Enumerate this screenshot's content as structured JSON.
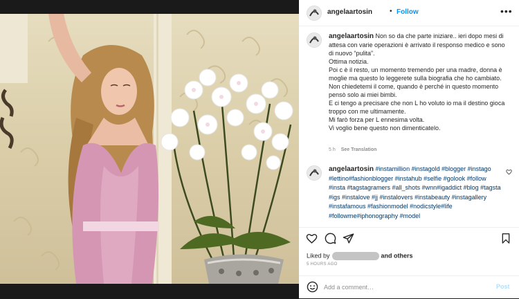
{
  "post": {
    "username": "angelaartosin",
    "separator": "•",
    "follow_label": "Follow",
    "more_label": "•••",
    "image_alt": "Woman in pink satin dress beside white orchids"
  },
  "caption": {
    "username": "angelaartosin",
    "lines": [
      "Non so da che parte iniziare.. ieri dopo mesi di attesa con varie operazioni è arrivato il responso medico e sono di nuovo “pulita”.",
      "Ottima notizia.",
      "Poi c è il resto, un momento tremendo per una madre, donna è moglie ma questo lo leggerete sulla biografia che ho cambiato.",
      "Non chiedetemi il come, quando è perché in questo momento pensò solo ai miei bimbi.",
      "E ci tengo a precisare che non L ho voluto io ma il destino gioca troppo con me ultimamente.",
      "Mi farò forza per L ennesima volta.",
      "Vi voglio bene questo non dimenticatelo."
    ],
    "age": "5 h",
    "see_translation": "See Translation"
  },
  "hashtag_comment": {
    "username": "angelaartosin",
    "tags": "#instamillion #instagold #blogger #instago #lettino#fashionblogger #instahub #selfie #golook #follow #insta #tagstagramers #all_shots #wnn#igaddict #blog #tagsta #igs #instalove #jj #instalovers #instabeauty #instagallery #instafamous #fashionmodel #nodicstyle#life #followme#iphonography #model"
  },
  "actions": {
    "liked_prefix": "Liked by",
    "liked_suffix": "and others",
    "timestamp": "5 HOURS AGO"
  },
  "add_comment": {
    "placeholder": "Add a comment…",
    "post_label": "Post"
  },
  "icons": {
    "header_avatar": "avatar-icon",
    "like": "heart-icon",
    "comment": "comment-bubble-icon",
    "share": "paper-plane-icon",
    "save": "bookmark-icon",
    "emoji": "smiley-icon"
  },
  "colors": {
    "link": "#0095f6",
    "hashtag": "#00376b",
    "muted": "#8e8e8e",
    "post_disabled": "#b2dffc"
  }
}
